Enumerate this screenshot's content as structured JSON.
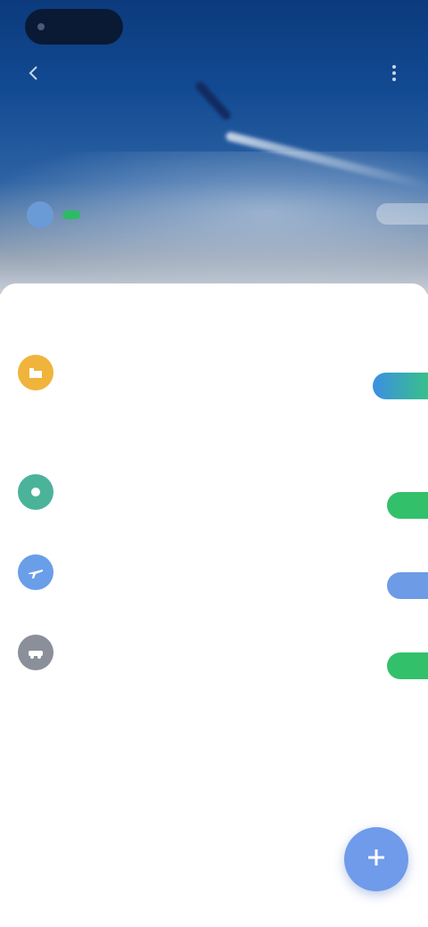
{
  "status_bar": {
    "time": "",
    "right": ""
  },
  "hero": {
    "title": "",
    "route": "",
    "status_badge": "",
    "subtitle": "",
    "colors": {
      "sky_top": "#0c3a7d",
      "badge": "#2dbb63",
      "status_icon": "#6b9bd6"
    },
    "icons": {
      "back": "back-arrow-icon",
      "more": "more-icon"
    }
  },
  "sections": [
    {
      "header": "",
      "items": [
        {
          "icon": "hotel-icon",
          "icon_color": "#f0b43c",
          "title": "",
          "subtitle": "",
          "value": "",
          "badge": "",
          "badge_color": "#3b8fe3"
        }
      ]
    },
    {
      "header": "",
      "items": [
        {
          "icon": "travel-icon",
          "icon_color": "#4bb39a",
          "title": "",
          "subtitle": "",
          "value": "",
          "badge": "",
          "badge_color": "#33c06a"
        },
        {
          "icon": "flight-icon",
          "icon_color": "#6a9ee8",
          "title": "",
          "subtitle": "",
          "value": "",
          "badge": "",
          "badge_color": "#6d9be6"
        },
        {
          "icon": "car-icon",
          "icon_color": "#8a8f99",
          "title": "",
          "subtitle": "",
          "value": "",
          "badge": "",
          "badge_color": "#33c06a"
        }
      ]
    }
  ],
  "fab": {
    "icon": "add-icon",
    "label": "",
    "color": "#6f9bea"
  }
}
